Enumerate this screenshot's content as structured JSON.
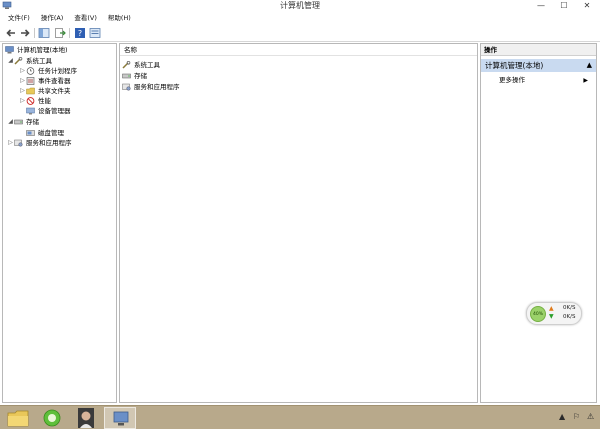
{
  "window": {
    "title": "计算机管理",
    "minimize": "—",
    "maximize": "☐",
    "close": "✕"
  },
  "menu": [
    "文件(F)",
    "操作(A)",
    "查看(V)",
    "帮助(H)"
  ],
  "toolbar": {
    "icons": [
      "back-arrow-icon",
      "forward-arrow-icon",
      "show-hide-tree-icon",
      "export-list-icon",
      "help-icon",
      "properties-icon"
    ]
  },
  "tree": {
    "root": "计算机管理(本地)",
    "system_tools": "系统工具",
    "task_scheduler": "任务计划程序",
    "event_viewer": "事件查看器",
    "shared_folders": "共享文件夹",
    "performance": "性能",
    "device_manager": "设备管理器",
    "storage": "存储",
    "disk_management": "磁盘管理",
    "services_apps": "服务和应用程序"
  },
  "center": {
    "column_header": "名称",
    "items": [
      "系统工具",
      "存储",
      "服务和应用程序"
    ]
  },
  "actions": {
    "header": "操作",
    "selected": "计算机管理(本地)",
    "more": "更多操作",
    "collapse_arrow": "▲",
    "expand_arrow": "▶"
  },
  "net_widget": {
    "percent": "40%",
    "upload_speed": "0K/S",
    "download_speed": "0K/S"
  },
  "colors": {
    "selection": "#c9daf0",
    "taskbar": "#b8a98b",
    "gauge": "#9bd26a"
  }
}
